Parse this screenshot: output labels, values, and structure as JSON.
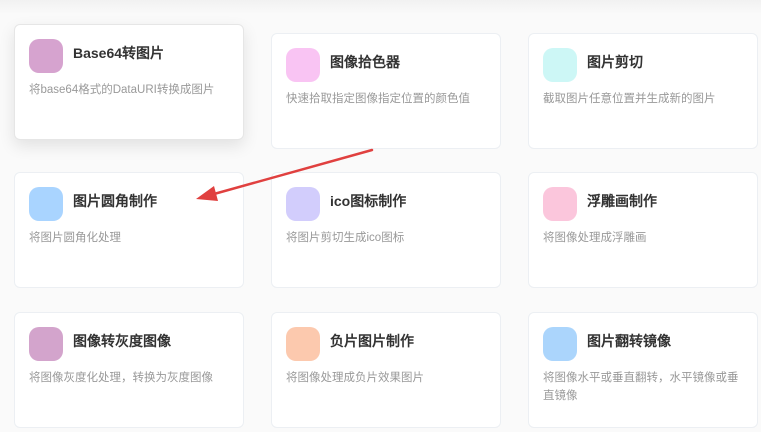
{
  "tools": [
    {
      "title": "Base64转图片",
      "desc": "将base64格式的DataURI转换成图片",
      "icon": "base64-image-icon",
      "color": "#d6a3cf"
    },
    {
      "title": "图像拾色器",
      "desc": "快速拾取指定图像指定位置的颜色值",
      "icon": "color-picker-icon",
      "color": "#f9c4f3"
    },
    {
      "title": "图片剪切",
      "desc": "截取图片任意位置并生成新的图片",
      "icon": "image-crop-icon",
      "color": "#cdf7f6"
    },
    {
      "title": "图片圆角制作",
      "desc": "将图片圆角化处理",
      "icon": "rounded-corner-icon",
      "color": "#a9d4ff"
    },
    {
      "title": "ico图标制作",
      "desc": "将图片剪切生成ico图标",
      "icon": "ico-maker-icon",
      "color": "#d2cdfc"
    },
    {
      "title": "浮雕画制作",
      "desc": "将图像处理成浮雕画",
      "icon": "emboss-icon",
      "color": "#fbc6dc"
    },
    {
      "title": "图像转灰度图像",
      "desc": "将图像灰度化处理，转换为灰度图像",
      "icon": "grayscale-icon",
      "color": "#d3a4cc"
    },
    {
      "title": "负片图片制作",
      "desc": "将图像处理成负片效果图片",
      "icon": "negative-icon",
      "color": "#fcc9ae"
    },
    {
      "title": "图片翻转镜像",
      "desc": "将图像水平或垂直翻转，水平镜像或垂直镜像",
      "icon": "flip-mirror-icon",
      "color": "#abd5fc"
    }
  ],
  "annotation": {
    "arrow_color": "#e0403f"
  }
}
